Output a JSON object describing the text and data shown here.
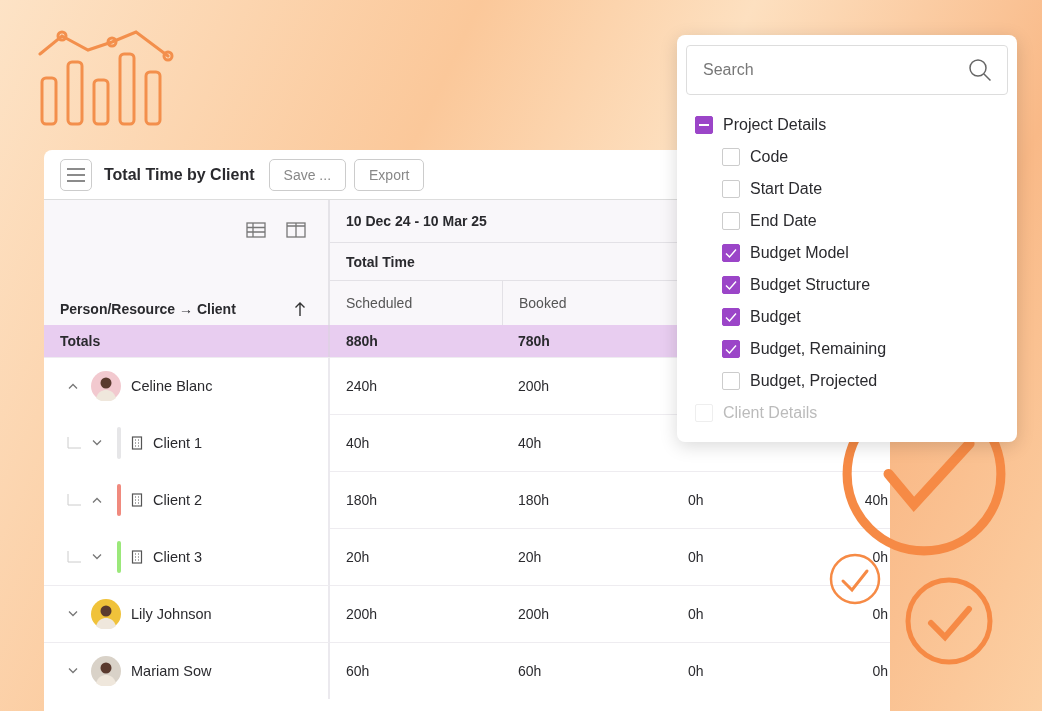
{
  "toolbar": {
    "title": "Total Time by Client",
    "buttons": [
      "Save ...",
      "Export"
    ]
  },
  "table": {
    "period": "10 Dec 24 - 10 Mar 25",
    "group": "Total Time",
    "row_header": "Person/Resource → Client",
    "columns": [
      "Scheduled",
      "Booked"
    ],
    "totals": {
      "label": "Totals",
      "values": [
        "880h",
        "780h"
      ]
    },
    "rows": [
      {
        "kind": "person",
        "name": "Celine Blanc",
        "expanded": true,
        "values": [
          "240h",
          "200h"
        ]
      },
      {
        "kind": "client",
        "name": "Client 1",
        "expanded": false,
        "color": "#e6e6e8",
        "values": [
          "40h",
          "40h"
        ]
      },
      {
        "kind": "client",
        "name": "Client 2",
        "expanded": true,
        "color": "#f08a7e",
        "values": [
          "180h",
          "180h",
          "0h",
          "40h"
        ]
      },
      {
        "kind": "client",
        "name": "Client 3",
        "expanded": false,
        "color": "#9be87a",
        "values": [
          "20h",
          "20h",
          "0h",
          "0h"
        ]
      },
      {
        "kind": "person",
        "name": "Lily Johnson",
        "expanded": false,
        "values": [
          "200h",
          "200h",
          "0h",
          "0h"
        ]
      },
      {
        "kind": "person",
        "name": "Mariam Sow",
        "expanded": false,
        "values": [
          "60h",
          "60h",
          "0h",
          "0h"
        ]
      }
    ]
  },
  "popup": {
    "search": {
      "placeholder": "Search"
    },
    "tree": [
      {
        "label": "Project Details",
        "indeterminate": true,
        "disabled": false,
        "children": [
          {
            "label": "Code",
            "checked": false,
            "disabled": false
          },
          {
            "label": "Start Date",
            "checked": false,
            "disabled": false
          },
          {
            "label": "End Date",
            "checked": false,
            "disabled": false
          },
          {
            "label": "Budget Model",
            "checked": true,
            "disabled": false
          },
          {
            "label": "Budget Structure",
            "checked": true,
            "disabled": false
          },
          {
            "label": "Budget",
            "checked": true,
            "disabled": false
          },
          {
            "label": "Budget, Remaining",
            "checked": true,
            "disabled": false
          },
          {
            "label": "Budget, Projected",
            "checked": false,
            "disabled": false
          }
        ]
      },
      {
        "label": "Client Details",
        "checked": false,
        "indeterminate": false,
        "disabled": true
      }
    ]
  }
}
